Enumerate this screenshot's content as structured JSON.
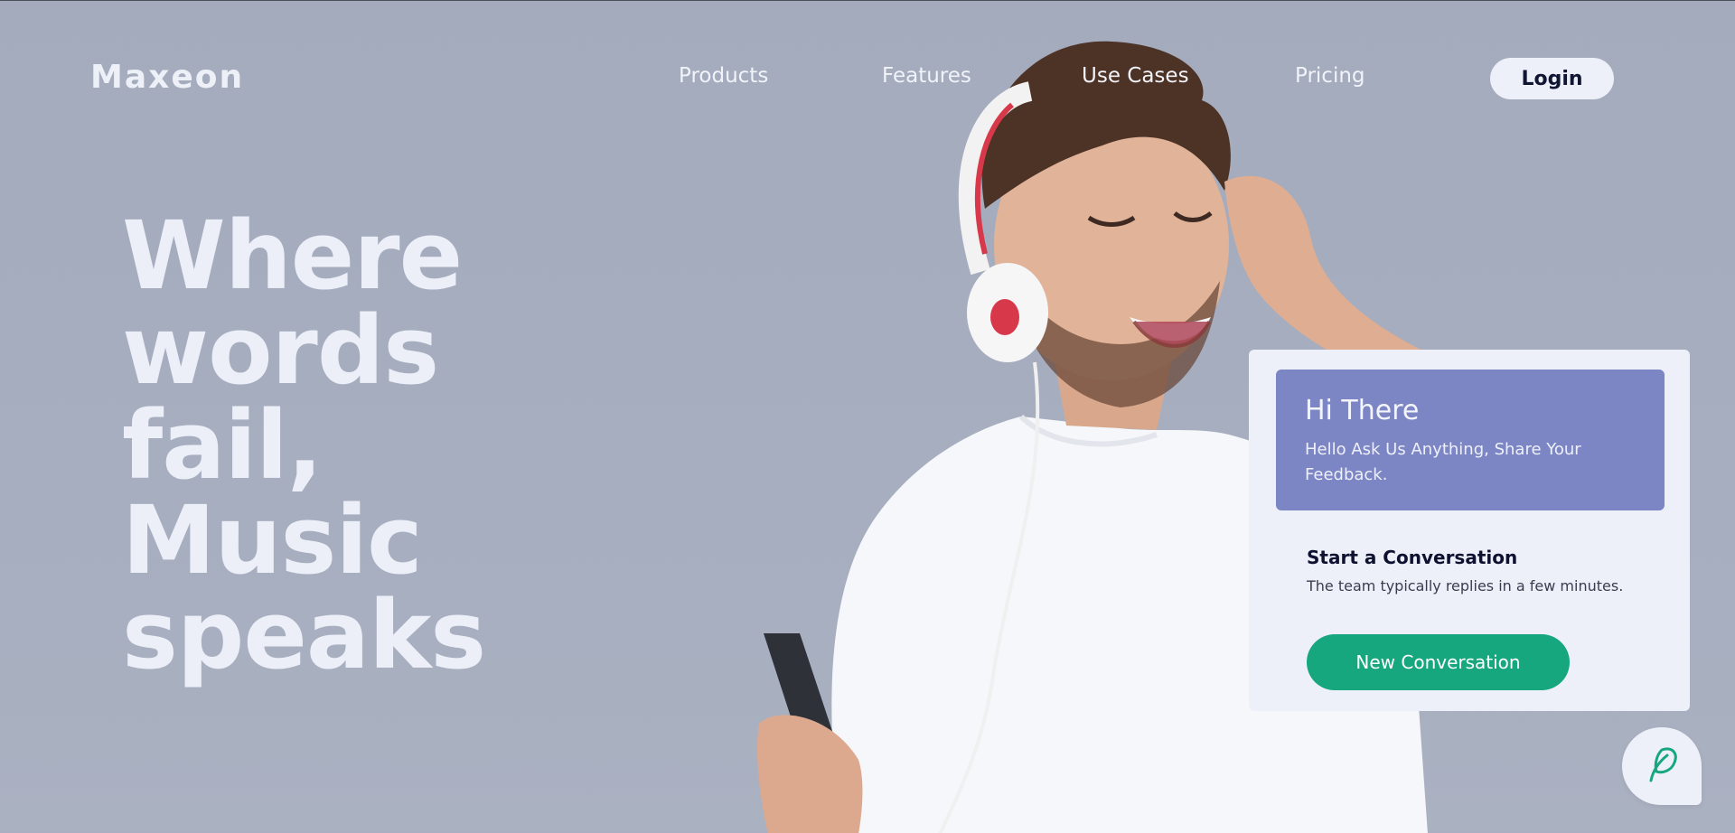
{
  "brand": {
    "name": "Maxeon"
  },
  "nav": {
    "items": [
      {
        "label": "Products"
      },
      {
        "label": "Features"
      },
      {
        "label": "Use Cases"
      },
      {
        "label": "Pricing"
      }
    ],
    "login_label": "Login"
  },
  "hero": {
    "headline_lines": [
      "Where",
      "words",
      "fail,",
      "Music",
      "speaks"
    ],
    "image": "man-with-headphones-and-phone"
  },
  "chat": {
    "greeting": "Hi There",
    "subtitle": "Hello Ask Us Anything, Share Your Feedback.",
    "start_title": "Start a Conversation",
    "start_text": "The team typically replies in a few minutes.",
    "button_label": "New Conversation",
    "launcher_icon": "chat-leaf-icon"
  },
  "colors": {
    "background": "#a5adbe",
    "chat_header": "#7d86c5",
    "accent_green": "#17a77e",
    "text_dark": "#111633"
  }
}
